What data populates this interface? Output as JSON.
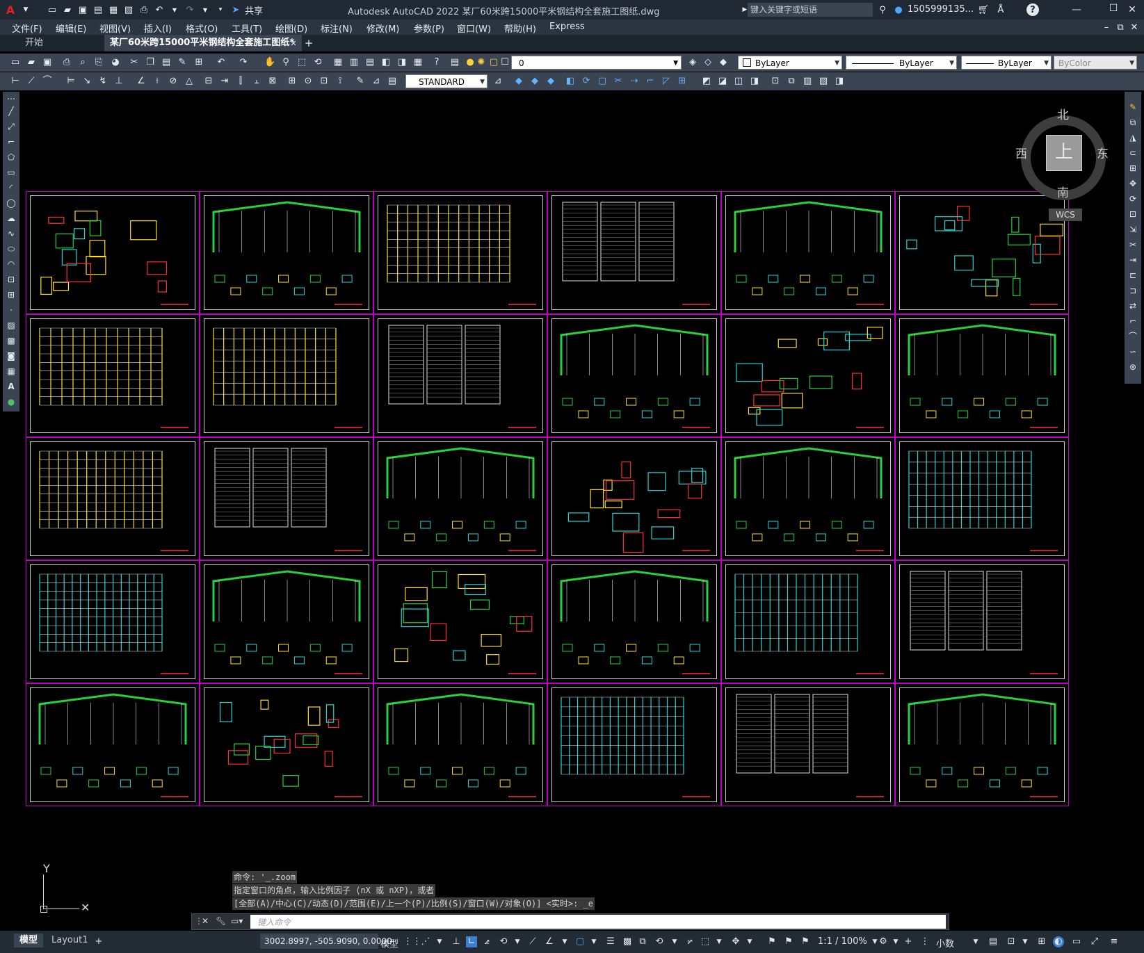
{
  "title_bar": {
    "app_title": "Autodesk AutoCAD 2022    某厂60米跨15000平米钢结构全套施工图纸.dwg",
    "share_label": "共享",
    "search_placeholder": "键入关键字或短语",
    "user": "1505999135..."
  },
  "menu": [
    "文件(F)",
    "编辑(E)",
    "视图(V)",
    "插入(I)",
    "格式(O)",
    "工具(T)",
    "绘图(D)",
    "标注(N)",
    "修改(M)",
    "参数(P)",
    "窗口(W)",
    "帮助(H)",
    "Express"
  ],
  "tabs": {
    "start": "开始",
    "document": "某厂60米跨15000平米钢结构全套施工图纸*"
  },
  "toolbar": {
    "layer_value": "0",
    "color_value": "ByLayer",
    "linetype_value": "ByLayer",
    "lineweight_value": "ByLayer",
    "plotstyle_value": "ByColor",
    "text_style": "STANDARD"
  },
  "viewcube": {
    "north": "北",
    "south": "南",
    "east": "东",
    "west": "西",
    "top": "上",
    "wcs": "WCS"
  },
  "command_history": [
    "命令: '_.zoom",
    "指定窗口的角点，输入比例因子 (nX 或 nXP)，或者",
    "[全部(A)/中心(C)/动态(D)/范围(E)/上一个(P)/比例(S)/窗口(W)/对象(O)] <实时>: _e"
  ],
  "command_input_placeholder": "键入命令",
  "ucs": {
    "y": "Y"
  },
  "status": {
    "model_tab": "模型",
    "layout_tab": "Layout1",
    "coords": "3002.8997, -505.9090, 0.0000",
    "space": "模型",
    "scale": "1:1 / 100%",
    "units": "小数"
  }
}
